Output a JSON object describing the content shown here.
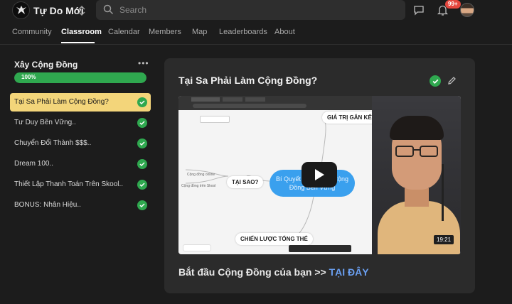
{
  "header": {
    "group_name": "Tự Do Mới",
    "search_placeholder": "Search",
    "notification_badge": "99+"
  },
  "nav": {
    "tabs": [
      "Community",
      "Classroom",
      "Calendar",
      "Members",
      "Map",
      "Leaderboards",
      "About"
    ],
    "active_tab": "Classroom"
  },
  "course": {
    "title": "Xây Cộng Đồng",
    "progress_label": "100%",
    "progress_fraction": 1.0,
    "lessons": [
      {
        "label": "Tại Sa Phải Làm Cộng Đồng?",
        "completed": true,
        "active": true
      },
      {
        "label": "Tư Duy Bền Vững..",
        "completed": true,
        "active": false
      },
      {
        "label": "Chuyển Đổi Thành $$$..",
        "completed": true,
        "active": false
      },
      {
        "label": "Dream 100..",
        "completed": true,
        "active": false
      },
      {
        "label": "Thiết Lập Thanh Toán Trên Skool..",
        "completed": true,
        "active": false
      },
      {
        "label": "BONUS: Nhân Hiệu..",
        "completed": true,
        "active": false
      }
    ]
  },
  "lesson": {
    "heading": "Tại Sa Phải Làm Cộng Đồng?",
    "video": {
      "duration": "19:21",
      "mindmap": {
        "center_line1": "Bí Quyết Xây Dựng Cộng",
        "center_line2": "Đồng Bền Vững",
        "node_top": "GIÁ TRỊ GẮN KẾT",
        "node_left": "TẠI SAO?",
        "node_bottom": "CHIẾN LƯỢC TỔNG THỂ",
        "sub1": "Cộng đồng online",
        "sub2": "Cộng đồng trên Skool"
      }
    },
    "cta_text": "Bắt đầu Cộng Đồng của bạn >> ",
    "cta_link": "TẠI ĐÂY"
  },
  "colors": {
    "accent_green": "#2fa84f",
    "active_lesson_bg": "#f3d57a",
    "link_blue": "#6a9ff0",
    "badge_red": "#e5473e"
  },
  "icons": [
    "logo-icon",
    "switcher-icon",
    "search-icon",
    "chat-icon",
    "bell-icon",
    "check-icon",
    "pencil-icon",
    "play-icon"
  ]
}
